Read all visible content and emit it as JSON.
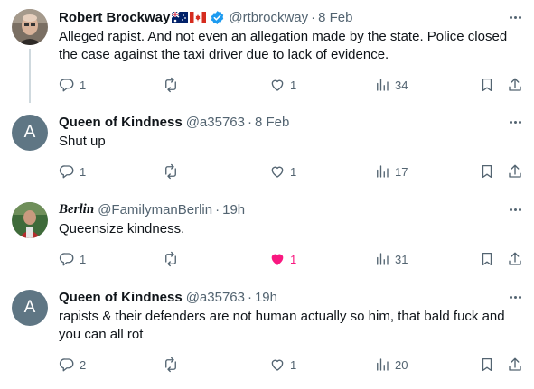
{
  "tweets": [
    {
      "name": "Robert Brockway",
      "flags": [
        "Australia",
        "Canada"
      ],
      "verified": true,
      "handle": "@rtbrockway",
      "time": "8 Feb",
      "text": "Alleged rapist.  And not even an allegation made by the state.  Police closed the case against the taxi driver due to lack of evidence.",
      "replies": "1",
      "retweets": "",
      "likes": "1",
      "views": "34"
    },
    {
      "name": "Queen of Kindness",
      "avatar_letter": "A",
      "handle": "@a35763",
      "time": "8 Feb",
      "text": "Shut up",
      "replies": "1",
      "retweets": "",
      "likes": "1",
      "views": "17"
    },
    {
      "name": "Berlin",
      "handle": "@FamilymanBerlin",
      "time": "19h",
      "text": "Queensize kindness.",
      "replies": "1",
      "retweets": "",
      "likes": "1",
      "liked": true,
      "views": "31"
    },
    {
      "name": "Queen of Kindness",
      "avatar_letter": "A",
      "handle": "@a35763",
      "time": "19h",
      "text": "rapists & their defenders are not human actually so him, that bald fuck and you can all rot",
      "replies": "2",
      "retweets": "",
      "likes": "1",
      "views": "20"
    }
  ],
  "colors": {
    "text": "#0f1419",
    "secondary": "#536471",
    "verified": "#1d9bf0",
    "like_active": "#f91880",
    "avatar_gray": "#5f7684"
  },
  "icons": {
    "reply": "reply-icon",
    "retweet": "retweet-icon",
    "like": "heart-icon",
    "views": "views-icon",
    "bookmark": "bookmark-icon",
    "share": "share-icon",
    "more": "more-icon"
  }
}
